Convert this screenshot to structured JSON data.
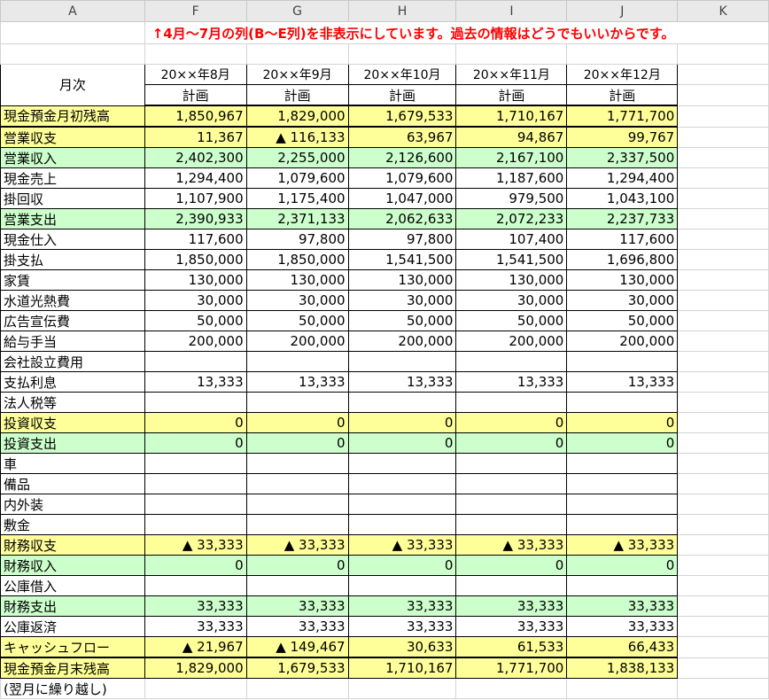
{
  "column_headers": [
    "A",
    "F",
    "G",
    "H",
    "I",
    "J",
    "K"
  ],
  "note": "↑4月～7月の列(B～E列)を非表示にしています。過去の情報はどうでもいいからです。",
  "row_label_header": "月次",
  "months": [
    "20××年8月",
    "20××年9月",
    "20××年10月",
    "20××年11月",
    "20××年12月"
  ],
  "plan_label": "計画",
  "rows": [
    {
      "label": "現金預金月初残高",
      "bg": "#ffff99",
      "values": [
        "1,850,967",
        "1,829,000",
        "1,679,533",
        "1,710,167",
        "1,771,700"
      ]
    },
    {
      "label": "営業収支",
      "bg": "#ffff99",
      "values": [
        "11,367",
        "▲ 116,133",
        "63,967",
        "94,867",
        "99,767"
      ]
    },
    {
      "label": "営業収入",
      "bg": "#ccffcc",
      "values": [
        "2,402,300",
        "2,255,000",
        "2,126,600",
        "2,167,100",
        "2,337,500"
      ]
    },
    {
      "label": "現金売上",
      "bg": "",
      "values": [
        "1,294,400",
        "1,079,600",
        "1,079,600",
        "1,187,600",
        "1,294,400"
      ]
    },
    {
      "label": "掛回収",
      "bg": "",
      "values": [
        "1,107,900",
        "1,175,400",
        "1,047,000",
        "979,500",
        "1,043,100"
      ]
    },
    {
      "label": "営業支出",
      "bg": "#ccffcc",
      "values": [
        "2,390,933",
        "2,371,133",
        "2,062,633",
        "2,072,233",
        "2,237,733"
      ]
    },
    {
      "label": "現金仕入",
      "bg": "",
      "values": [
        "117,600",
        "97,800",
        "97,800",
        "107,400",
        "117,600"
      ]
    },
    {
      "label": "掛支払",
      "bg": "",
      "values": [
        "1,850,000",
        "1,850,000",
        "1,541,500",
        "1,541,500",
        "1,696,800"
      ]
    },
    {
      "label": "家賃",
      "bg": "",
      "values": [
        "130,000",
        "130,000",
        "130,000",
        "130,000",
        "130,000"
      ]
    },
    {
      "label": "水道光熱費",
      "bg": "",
      "values": [
        "30,000",
        "30,000",
        "30,000",
        "30,000",
        "30,000"
      ]
    },
    {
      "label": "広告宣伝費",
      "bg": "",
      "values": [
        "50,000",
        "50,000",
        "50,000",
        "50,000",
        "50,000"
      ]
    },
    {
      "label": "給与手当",
      "bg": "",
      "values": [
        "200,000",
        "200,000",
        "200,000",
        "200,000",
        "200,000"
      ]
    },
    {
      "label": "会社設立費用",
      "bg": "",
      "values": [
        "",
        "",
        "",
        "",
        ""
      ]
    },
    {
      "label": "支払利息",
      "bg": "",
      "values": [
        "13,333",
        "13,333",
        "13,333",
        "13,333",
        "13,333"
      ]
    },
    {
      "label": "法人税等",
      "bg": "",
      "values": [
        "",
        "",
        "",
        "",
        ""
      ]
    },
    {
      "label": "投資収支",
      "bg": "#ffff99",
      "values": [
        "0",
        "0",
        "0",
        "0",
        "0"
      ]
    },
    {
      "label": "投資支出",
      "bg": "#ccffcc",
      "values": [
        "0",
        "0",
        "0",
        "0",
        "0"
      ]
    },
    {
      "label": "車",
      "bg": "",
      "values": [
        "",
        "",
        "",
        "",
        ""
      ]
    },
    {
      "label": "備品",
      "bg": "",
      "values": [
        "",
        "",
        "",
        "",
        ""
      ]
    },
    {
      "label": "内外装",
      "bg": "",
      "values": [
        "",
        "",
        "",
        "",
        ""
      ]
    },
    {
      "label": "敷金",
      "bg": "",
      "values": [
        "",
        "",
        "",
        "",
        ""
      ]
    },
    {
      "label": "財務収支",
      "bg": "#ffff99",
      "values": [
        "▲ 33,333",
        "▲ 33,333",
        "▲ 33,333",
        "▲ 33,333",
        "▲ 33,333"
      ]
    },
    {
      "label": "財務収入",
      "bg": "#ccffcc",
      "values": [
        "0",
        "0",
        "0",
        "0",
        "0"
      ]
    },
    {
      "label": "公庫借入",
      "bg": "",
      "values": [
        "",
        "",
        "",
        "",
        ""
      ]
    },
    {
      "label": "財務支出",
      "bg": "#ccffcc",
      "values": [
        "33,333",
        "33,333",
        "33,333",
        "33,333",
        "33,333"
      ]
    },
    {
      "label": "公庫返済",
      "bg": "",
      "values": [
        "33,333",
        "33,333",
        "33,333",
        "33,333",
        "33,333"
      ]
    },
    {
      "label": "キャッシュフロー",
      "bg": "#ffff99",
      "values": [
        "▲ 21,967",
        "▲ 149,467",
        "30,633",
        "61,533",
        "66,433"
      ]
    },
    {
      "label": "現金預金月末残高",
      "bg": "#ffff99",
      "values": [
        "1,829,000",
        "1,679,533",
        "1,710,167",
        "1,771,700",
        "1,838,133"
      ]
    }
  ],
  "footer_note": "(翌月に繰り越し)"
}
